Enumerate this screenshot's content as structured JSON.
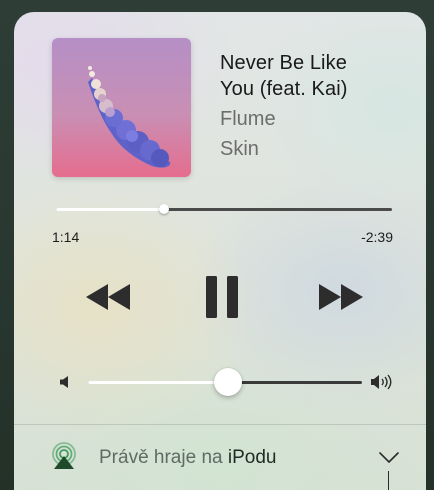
{
  "now_playing": {
    "title": "Never Be Like You (feat. Kai)",
    "title_line1": "Never Be Like",
    "title_line2": "You (feat. Kai)",
    "artist": "Flume",
    "album": "Skin",
    "album_art_icon": "flume-skin-album-art"
  },
  "playback": {
    "elapsed": "1:14",
    "remaining": "-2:39",
    "progress_fraction": 0.322,
    "state": "playing",
    "rewind_icon": "rewind-icon",
    "pause_icon": "pause-icon",
    "fast_forward_icon": "fast-forward-icon"
  },
  "volume": {
    "level_fraction": 0.51,
    "min_icon": "volume-low-icon",
    "max_icon": "volume-high-icon"
  },
  "output": {
    "label_prefix": "Právě hraje na",
    "device": "iPodu",
    "airplay_icon": "airplay-icon",
    "accent_color": "#3f9a5c",
    "expand_icon": "chevron-down-icon"
  }
}
